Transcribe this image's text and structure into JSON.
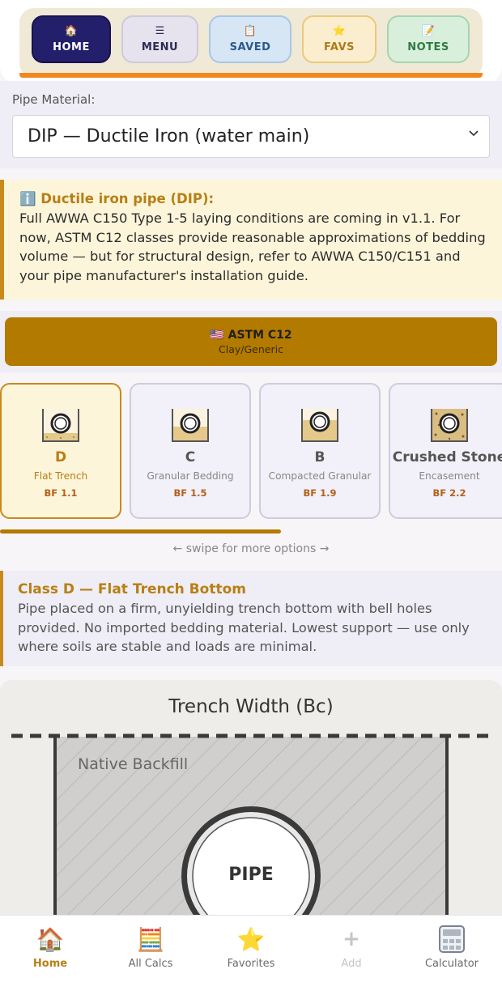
{
  "top_nav": {
    "items": [
      {
        "icon": "house-icon",
        "glyph": "🏠",
        "label": "HOME"
      },
      {
        "icon": "menu-icon",
        "glyph": "☰",
        "label": "MENU"
      },
      {
        "icon": "clipboard-icon",
        "glyph": "📋",
        "label": "SAVED"
      },
      {
        "icon": "star-icon",
        "glyph": "⭐",
        "label": "FAVS"
      },
      {
        "icon": "memo-icon",
        "glyph": "📝",
        "label": "NOTES"
      }
    ],
    "colors": {
      "home": "#241f6b",
      "accent_bar": "#f2871f"
    }
  },
  "material": {
    "label": "Pipe Material:",
    "selected": "DIP — Ductile Iron (water main)"
  },
  "info": {
    "title": "ℹ️ Ductile iron pipe (DIP):",
    "body": "Full AWWA C150 Type 1-5 laying conditions are coming in v1.1. For now, ASTM C12 classes provide reasonable approximations of bedding volume — but for structural design, refer to AWWA C150/C151 and your pipe manufacturer's installation guide."
  },
  "standard": {
    "title": "🇺🇸 ASTM C12",
    "subtitle": "Clay/Generic",
    "color": "#b37a00"
  },
  "classes": [
    {
      "letter": "D",
      "desc": "Flat Trench",
      "bf": "BF 1.1",
      "selected": true
    },
    {
      "letter": "C",
      "desc": "Granular Bedding",
      "bf": "BF 1.5",
      "selected": false
    },
    {
      "letter": "B",
      "desc": "Compacted Granular",
      "bf": "BF 1.9",
      "selected": false
    },
    {
      "letter": "Crushed Stone",
      "desc": "Encasement",
      "bf": "BF 2.2",
      "selected": false
    }
  ],
  "swipe_hint": "← swipe for more options →",
  "class_detail": {
    "title": "Class D — Flat Trench Bottom",
    "body": "Pipe placed on a firm, unyielding trench bottom with bell holes provided. No imported bedding material. Lowest support — use only where soils are stable and loads are minimal."
  },
  "diagram": {
    "title": "Trench Width (Bc)",
    "backfill_label": "Native Backfill",
    "pipe_label": "PIPE"
  },
  "bottom_nav": {
    "items": [
      {
        "icon": "house-icon",
        "glyph": "🏠",
        "label": "Home"
      },
      {
        "icon": "abacus-icon",
        "glyph": "🧮",
        "label": "All Calcs"
      },
      {
        "icon": "star-icon",
        "glyph": "⭐",
        "label": "Favorites"
      },
      {
        "icon": "plus-icon",
        "glyph": "+",
        "label": "Add"
      },
      {
        "icon": "calculator-icon",
        "glyph": "",
        "label": "Calculator"
      }
    ],
    "active_color": "#b77f14"
  }
}
